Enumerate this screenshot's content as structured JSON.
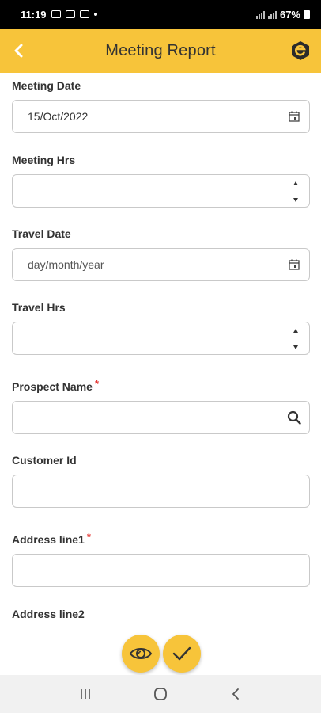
{
  "status_bar": {
    "time": "11:19",
    "battery": "67%"
  },
  "app_bar": {
    "title": "Meeting Report",
    "back_icon": "chevron-left-icon",
    "logo_icon": "app-logo-icon"
  },
  "form": {
    "meeting_date": {
      "label": "Meeting Date",
      "value": "15/Oct/2022",
      "icon": "calendar-icon"
    },
    "meeting_hrs": {
      "label": "Meeting Hrs",
      "value": ""
    },
    "travel_date": {
      "label": "Travel Date",
      "placeholder": "day/month/year",
      "icon": "calendar-icon"
    },
    "travel_hrs": {
      "label": "Travel Hrs",
      "value": ""
    },
    "prospect_name": {
      "label": "Prospect Name",
      "required_mark": "*",
      "value": "",
      "icon": "search-icon"
    },
    "customer_id": {
      "label": "Customer Id",
      "value": ""
    },
    "address_line1": {
      "label": "Address line1",
      "required_mark": "*",
      "value": ""
    },
    "address_line2": {
      "label": "Address line2"
    }
  },
  "actions": {
    "preview_icon": "eye-icon",
    "submit_icon": "check-icon"
  },
  "colors": {
    "accent": "#f7c43a",
    "required": "#e53935"
  },
  "nav_bar": {
    "recents_icon": "recents-icon",
    "home_icon": "home-icon",
    "back_icon": "back-icon"
  }
}
